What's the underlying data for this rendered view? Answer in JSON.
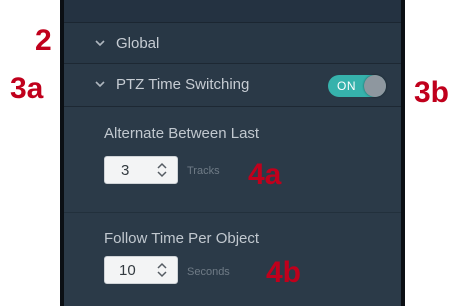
{
  "callouts": {
    "global": "2",
    "ptz_row": "3a",
    "toggle": "3b",
    "tracks": "4a",
    "seconds": "4b"
  },
  "panel": {
    "global_section": {
      "label": "Global",
      "icon": "chevron-down-icon"
    },
    "ptz_section": {
      "label": "PTZ Time Switching",
      "icon": "chevron-down-icon",
      "toggle": {
        "text": "ON",
        "state": "on"
      }
    },
    "alternate": {
      "label": "Alternate Between Last",
      "value": "3",
      "unit": "Tracks"
    },
    "follow": {
      "label": "Follow Time Per Object",
      "value": "10",
      "unit": "Seconds"
    }
  },
  "colors": {
    "callout": "#c0001c",
    "panel_bg": "#2b3a48",
    "toggle_on": "#36b2ac"
  }
}
